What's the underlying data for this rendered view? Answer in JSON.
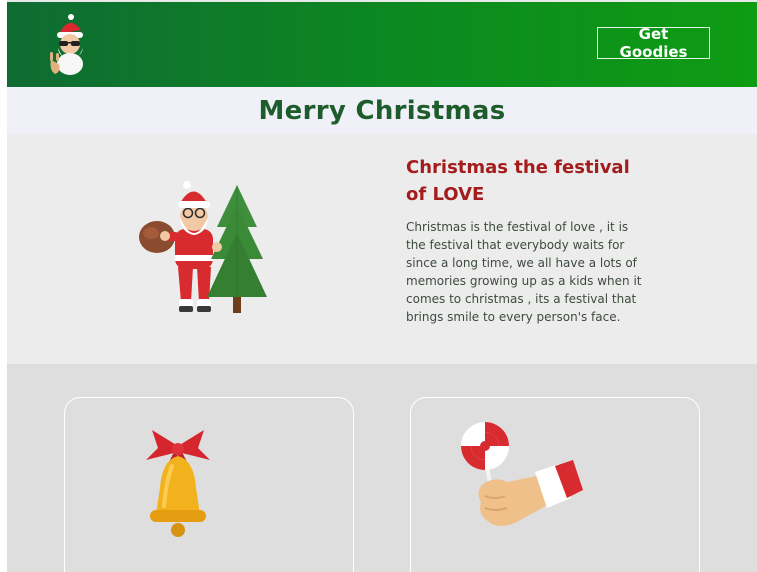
{
  "header": {
    "cta_label": "Get Goodies",
    "logo_icon": "santa-logo-icon"
  },
  "banner": {
    "title": "Merry Christmas"
  },
  "hero": {
    "title": "Christmas the festival of LOVE",
    "text": "Christmas is the festival of love , it is the festival that everybody waits for since a long time, we all have a lots of memories growing up as a kids when it comes to christmas , its a festival that brings smile to every person's face.",
    "image_icon": "santa-with-tree-icon"
  },
  "cards": [
    {
      "icon": "bell-icon"
    },
    {
      "icon": "lollipop-hand-icon"
    }
  ],
  "colors": {
    "nav_start": "#0f6b33",
    "nav_end": "#0e9c12",
    "banner_bg": "#eff0f8",
    "banner_text": "#1d5d2c",
    "hero_bg": "#ececec",
    "hero_title": "#a31d1d",
    "cards_bg": "#dedede"
  }
}
